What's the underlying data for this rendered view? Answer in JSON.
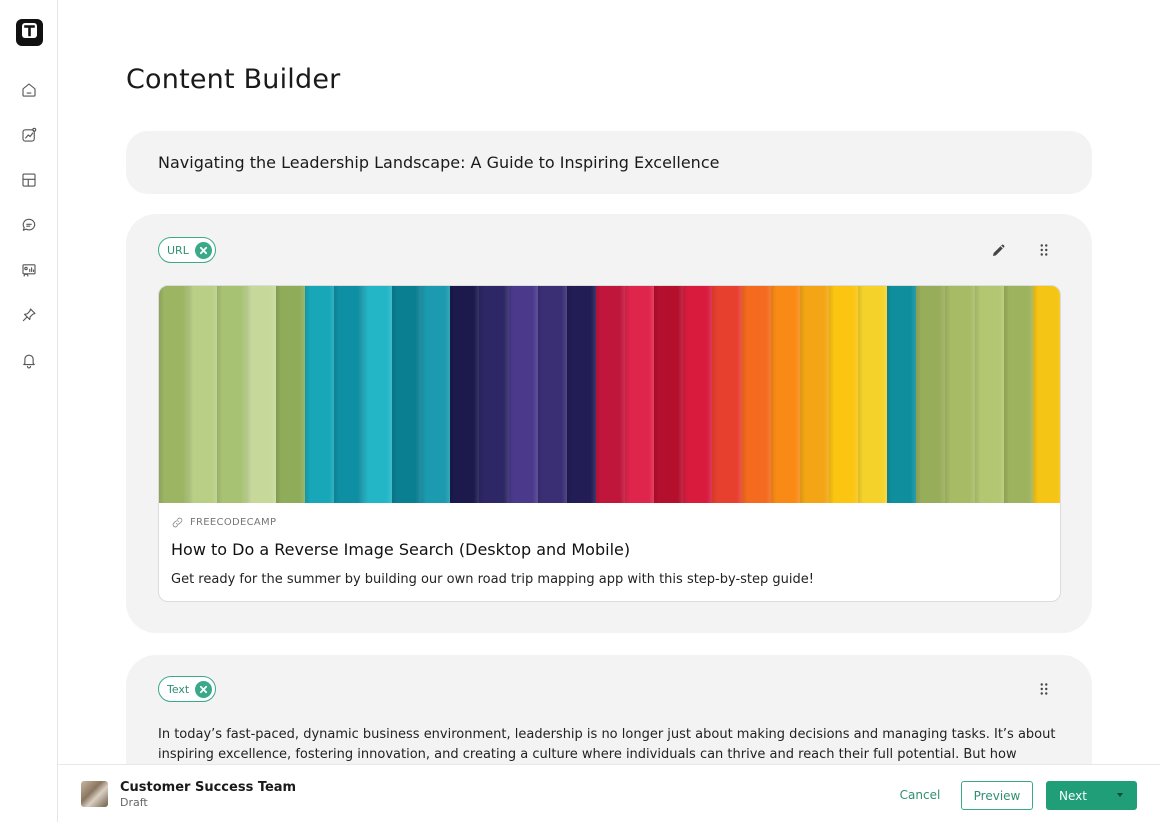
{
  "app": {
    "logo_letter": "T",
    "page_title": "Content Builder"
  },
  "sidebar": {
    "items": [
      {
        "icon": "home-icon"
      },
      {
        "icon": "analytics-icon"
      },
      {
        "icon": "layout-grid-icon"
      },
      {
        "icon": "chat-icon"
      },
      {
        "icon": "reports-icon"
      },
      {
        "icon": "pin-icon"
      },
      {
        "icon": "bell-icon"
      }
    ]
  },
  "post": {
    "title": "Navigating the Leadership Landscape: A Guide to Inspiring Excellence"
  },
  "url_block": {
    "chip_label": "URL",
    "link": {
      "source": "FREECODECAMP",
      "title": "How to Do a Reverse Image Search (Desktop and Mobile)",
      "description": "Get ready for the summer by building our own road trip mapping app with this step-by-step guide!"
    },
    "hero_colors": [
      "#9bb563",
      "#b9cf86",
      "#a8c274",
      "#c6d99a",
      "#8fac5b",
      "#17a7b8",
      "#0f8fa3",
      "#23b6c6",
      "#0b7f92",
      "#1c9aaf",
      "#1c1a4d",
      "#2d2766",
      "#4b3a8c",
      "#3a2f74",
      "#221d55",
      "#c0163c",
      "#e0254c",
      "#b50f2e",
      "#d91c3e",
      "#e8402f",
      "#f46a1e",
      "#f98a16",
      "#f4a516",
      "#fbc512",
      "#f5d22a",
      "#0f8f9e",
      "#98ad5a",
      "#a7bb66",
      "#b3c672",
      "#9db35d",
      "#f5c515"
    ]
  },
  "text_block": {
    "chip_label": "Text",
    "body": "In today’s fast-paced, dynamic business environment, leadership is no longer just about making decisions and managing tasks. It’s about inspiring excellence, fostering innovation, and creating a culture where individuals can thrive and reach their full potential. But how"
  },
  "footer": {
    "team_name": "Customer Success Team",
    "status": "Draft",
    "cancel_label": "Cancel",
    "preview_label": "Preview",
    "next_label": "Next"
  },
  "colors": {
    "accent": "#1f9e78",
    "chip_border": "#3aa98a",
    "card_bg": "#f3f3f3"
  }
}
